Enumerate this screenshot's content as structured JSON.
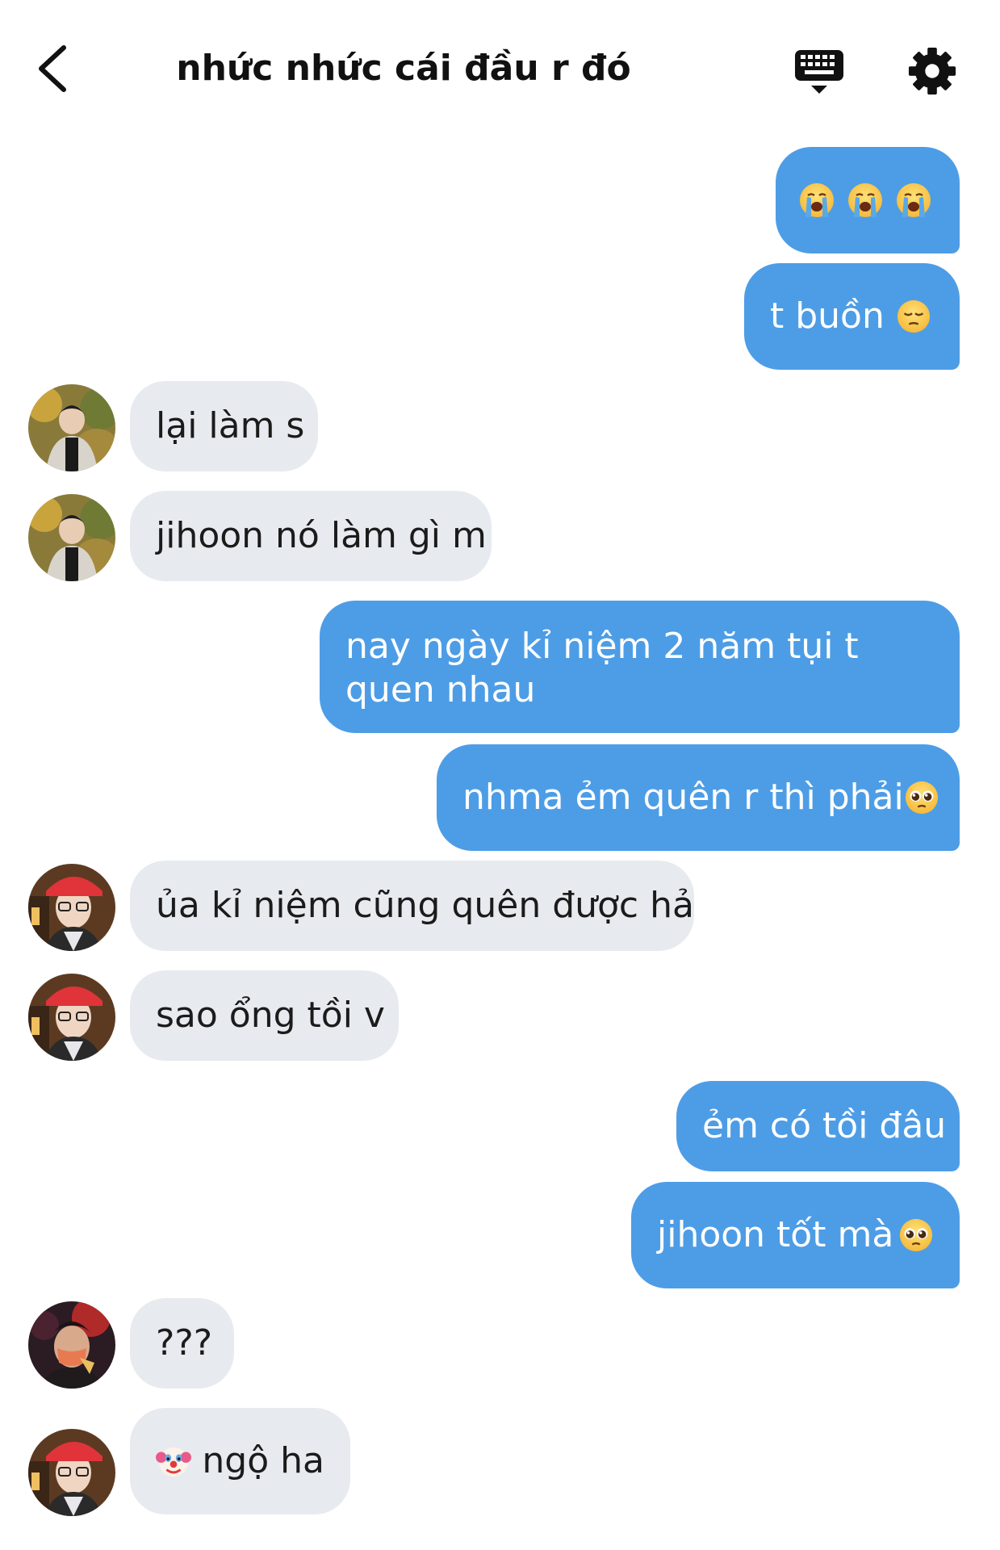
{
  "header": {
    "title": "nhức nhức cái đầu r đó",
    "back_icon": "chevron-left-icon",
    "keyboard_icon": "keyboard-icon",
    "settings_icon": "gear-icon"
  },
  "colors": {
    "outgoing_bubble": "#4d9de6",
    "incoming_bubble": "#e7eaee"
  },
  "messages": [
    {
      "direction": "out",
      "text": "",
      "emojis": [
        "loudly-crying-face",
        "loudly-crying-face",
        "loudly-crying-face"
      ]
    },
    {
      "direction": "out",
      "text": "t buồn",
      "emojis": [
        "pensive-face"
      ]
    },
    {
      "direction": "in",
      "avatar": "avatar-user-a",
      "text": "lại làm s"
    },
    {
      "direction": "in",
      "avatar": "avatar-user-a",
      "text": "jihoon nó làm gì m"
    },
    {
      "direction": "out",
      "text": "nay ngày kỉ niệm 2 năm tụi t quen nhau"
    },
    {
      "direction": "out",
      "text": "nhma ẻm quên r thì phải",
      "emojis": [
        "pleading-face"
      ]
    },
    {
      "direction": "in",
      "avatar": "avatar-user-b",
      "text": "ủa kỉ niệm cũng quên được hả"
    },
    {
      "direction": "in",
      "avatar": "avatar-user-b",
      "text": "sao ổng tồi v"
    },
    {
      "direction": "out",
      "text": "ẻm có tồi đâu"
    },
    {
      "direction": "out",
      "text": "jihoon tốt mà",
      "emojis": [
        "pleading-face"
      ]
    },
    {
      "direction": "in",
      "avatar": "avatar-user-c",
      "text": "???"
    },
    {
      "direction": "in",
      "avatar": "avatar-user-b",
      "text": "ngộ ha",
      "emojis_before": [
        "clown-face"
      ]
    }
  ]
}
